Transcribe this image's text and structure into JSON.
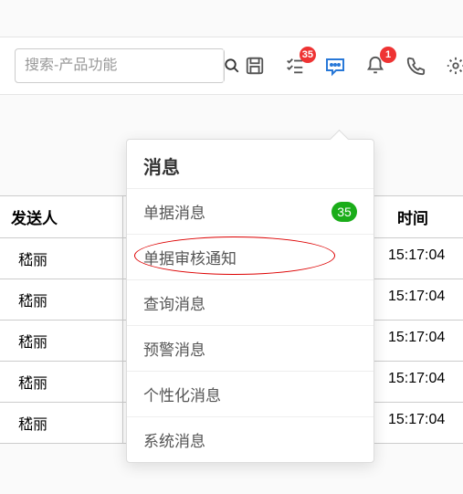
{
  "search": {
    "placeholder": "搜索-产品功能"
  },
  "toolbar": {
    "msg_badge": "35",
    "bell_badge": "1"
  },
  "table": {
    "headers": {
      "sender": "发送人",
      "time": "时间"
    },
    "rows": [
      {
        "sender": "嵇丽",
        "time": "15:17:04"
      },
      {
        "sender": "嵇丽",
        "time": "15:17:04"
      },
      {
        "sender": "嵇丽",
        "time": "15:17:04"
      },
      {
        "sender": "嵇丽",
        "time": "15:17:04"
      },
      {
        "sender": "嵇丽",
        "time": "15:17:04"
      }
    ]
  },
  "dropdown": {
    "title": "消息",
    "items": [
      {
        "label": "单据消息",
        "badge": "35"
      },
      {
        "label": "单据审核通知",
        "highlight": true
      },
      {
        "label": "查询消息"
      },
      {
        "label": "预警消息"
      },
      {
        "label": "个性化消息"
      },
      {
        "label": "系统消息"
      }
    ]
  }
}
